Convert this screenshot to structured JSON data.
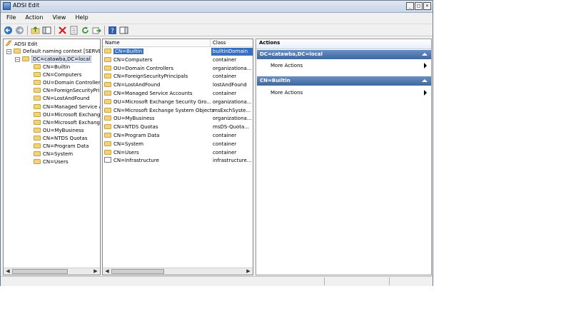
{
  "window": {
    "title": "ADSI Edit",
    "icon": "adsi-icon"
  },
  "menubar": [
    {
      "label": "File"
    },
    {
      "label": "Action"
    },
    {
      "label": "View"
    },
    {
      "label": "Help"
    }
  ],
  "tree": {
    "root": "ADSI Edit",
    "context": "Default naming context [SERVE",
    "domain": "DC=catawba,DC=local",
    "items": [
      "CN=Builtin",
      "CN=Computers",
      "OU=Domain Controllers",
      "CN=ForeignSecurityPrin",
      "CN=LostAndFound",
      "CN=Managed Service A",
      "OU=Microsoft Exchang",
      "CN=Microsoft Exchang",
      "OU=MyBusiness",
      "CN=NTDS Quotas",
      "CN=Program Data",
      "CN=System",
      "CN=Users"
    ]
  },
  "list": {
    "columns": {
      "name": "Name",
      "class": "Class"
    },
    "rows": [
      {
        "name": "CN=Builtin",
        "class": "builtinDomain"
      },
      {
        "name": "CN=Computers",
        "class": "container"
      },
      {
        "name": "OU=Domain Controllers",
        "class": "organizationa..."
      },
      {
        "name": "CN=ForeignSecurityPrincipals",
        "class": "container"
      },
      {
        "name": "CN=LostAndFound",
        "class": "lostAndFound"
      },
      {
        "name": "CN=Managed Service Accounts",
        "class": "container"
      },
      {
        "name": "OU=Microsoft Exchange Security Gro...",
        "class": "organizationa..."
      },
      {
        "name": "CN=Microsoft Exchange System Objects",
        "class": "msExchSyste..."
      },
      {
        "name": "OU=MyBusiness",
        "class": "organizationa..."
      },
      {
        "name": "CN=NTDS Quotas",
        "class": "msDS-Quota..."
      },
      {
        "name": "CN=Program Data",
        "class": "container"
      },
      {
        "name": "CN=System",
        "class": "container"
      },
      {
        "name": "CN=Users",
        "class": "container"
      },
      {
        "name": "CN=Infrastructure",
        "class": "infrastructure..."
      }
    ]
  },
  "actions": {
    "title": "Actions",
    "sections": [
      {
        "header": "DC=catawba,DC=local",
        "item": "More Actions"
      },
      {
        "header": "CN=Builtin",
        "item": "More Actions"
      }
    ]
  },
  "window_buttons": {
    "minimize": "_",
    "maximize": "□",
    "close": "×"
  },
  "colors": {
    "selection": "#3470c4",
    "action_header": "#4a72a8"
  }
}
